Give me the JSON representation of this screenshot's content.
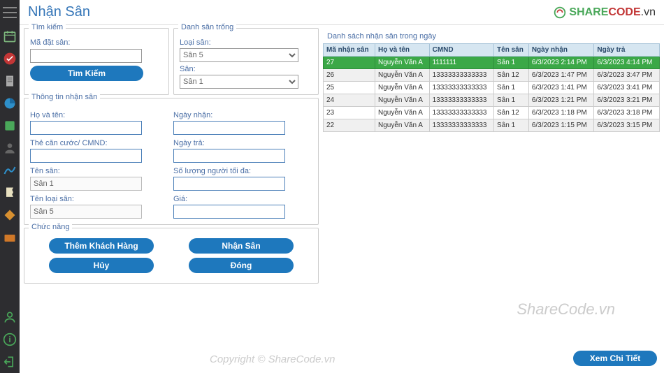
{
  "header": {
    "title": "Nhận Sân",
    "brand_1": "SHARE",
    "brand_2": "CODE",
    "brand_3": ".vn"
  },
  "panels": {
    "search": {
      "title": "Tìm kiếm",
      "code_label": "Mã đặt sân:",
      "search_btn": "Tìm Kiếm"
    },
    "empty": {
      "title": "Danh sân trống",
      "type_label": "Loại sân:",
      "type_value": "Sân 5",
      "field_label": "Sân:",
      "field_value": "Sân 1"
    },
    "info": {
      "title": "Thông tin nhận sân",
      "name_label": "Họ và tên:",
      "id_label": "Thẻ căn cước/ CMND:",
      "fieldname_label": "Tên sân:",
      "fieldname_value": "Sân 1",
      "fieldtype_label": "Tên loại sân:",
      "fieldtype_value": "Sân 5",
      "checkin_label": "Ngày nhận:",
      "checkout_label": "Ngày trả:",
      "max_label": "Số lượng người tối đa:",
      "price_label": "Giá:"
    },
    "func": {
      "title": "Chức năng",
      "add": "Thêm Khách Hàng",
      "receive": "Nhận Sân",
      "cancel": "Hủy",
      "close": "Đóng"
    },
    "list": {
      "title": "Danh sách nhận sân trong ngày",
      "detail_btn": "Xem Chi Tiết",
      "headers": [
        "Mã nhận sân",
        "Họ và tên",
        "CMND",
        "Tên sân",
        "Ngày nhận",
        "Ngày trả"
      ],
      "rows": [
        {
          "id": "27",
          "name": "Nguyễn Văn A",
          "cmnd": "1111111",
          "field": "Sân 1",
          "in": "6/3/2023 2:14 PM",
          "out": "6/3/2023 4:14 PM",
          "cls": "green"
        },
        {
          "id": "26",
          "name": "Nguyễn Văn A",
          "cmnd": "13333333333333",
          "field": "Sân 12",
          "in": "6/3/2023 1:47 PM",
          "out": "6/3/2023 3:47 PM",
          "cls": "alt"
        },
        {
          "id": "25",
          "name": "Nguyễn Văn A",
          "cmnd": "13333333333333",
          "field": "Sân 1",
          "in": "6/3/2023 1:41 PM",
          "out": "6/3/2023 3:41 PM",
          "cls": "norm"
        },
        {
          "id": "24",
          "name": "Nguyễn Văn A",
          "cmnd": "13333333333333",
          "field": "Sân 1",
          "in": "6/3/2023 1:21 PM",
          "out": "6/3/2023 3:21 PM",
          "cls": "alt"
        },
        {
          "id": "23",
          "name": "Nguyễn Văn A",
          "cmnd": "13333333333333",
          "field": "Sân 12",
          "in": "6/3/2023 1:18 PM",
          "out": "6/3/2023 3:18 PM",
          "cls": "norm"
        },
        {
          "id": "22",
          "name": "Nguyễn Văn A",
          "cmnd": "13333333333333",
          "field": "Sân 1",
          "in": "6/3/2023 1:15 PM",
          "out": "6/3/2023 3:15 PM",
          "cls": "alt"
        }
      ]
    }
  },
  "watermarks": {
    "wm1": "ShareCode.vn",
    "wm2": "Copyright © ShareCode.vn"
  }
}
